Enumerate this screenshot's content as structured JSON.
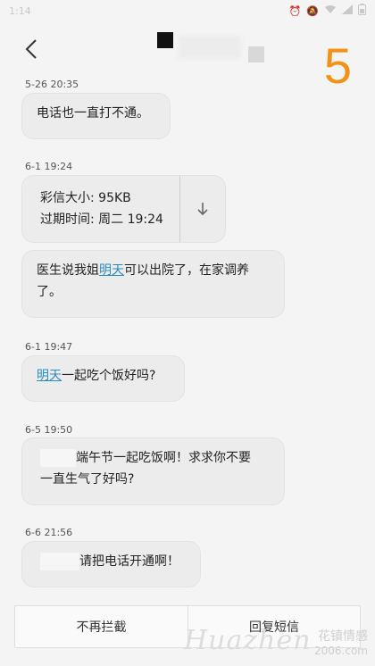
{
  "status_bar": {
    "time": "1:14",
    "icons": [
      "alarm-icon",
      "mute-icon",
      "wifi-icon",
      "signal-icon",
      "battery-icon"
    ]
  },
  "header": {
    "back_icon": "chevron-left-icon",
    "step_number": "5",
    "step_color": "#f29318"
  },
  "messages": [
    {
      "timestamp": "5-26 20:35",
      "text": "电话也一直打不通。"
    },
    {
      "timestamp": "6-1 19:24",
      "mms": {
        "size_label": "彩信大小: 95KB",
        "expire_label": "过期时间: 周二 19:24",
        "download_icon": "download-arrow-icon"
      }
    },
    {
      "text_before": "医生说我姐",
      "link": "明天",
      "text_after": "可以出院了，在家调养",
      "text_line2": "了。"
    },
    {
      "timestamp": "6-1 19:47",
      "link": "明天",
      "text_after": "一起吃个饭好吗?"
    },
    {
      "timestamp": "6-5 19:50",
      "line1": "端午节一起吃饭啊！求求你不要",
      "line2": "一直生气了好吗?"
    },
    {
      "timestamp": "6-6 21:56",
      "text": "请把电话开通啊！"
    }
  ],
  "bottom_bar": {
    "unblock_label": "不再拦截",
    "reply_label": "回复短信"
  },
  "watermark": {
    "main": "Huazhen",
    "cn": "花镇情感",
    "url": "2006.com"
  },
  "colors": {
    "link": "#2a8bc4",
    "bubble": "#ececec",
    "background": "#f4f4f4"
  }
}
